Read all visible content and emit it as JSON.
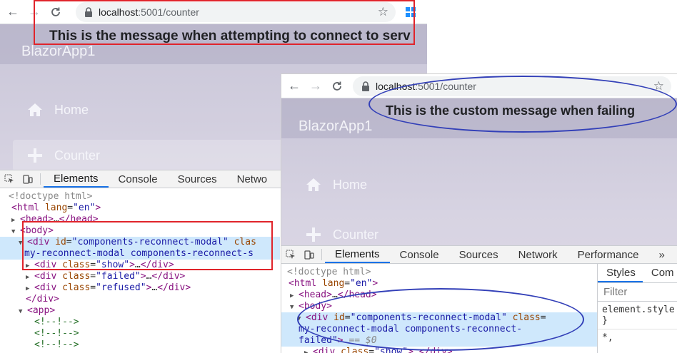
{
  "shot1": {
    "url_host": "localhost",
    "url_path": ":5001/counter",
    "reconnect_message": "This is the message when attempting to connect to serv",
    "brand": "BlazorApp1",
    "nav": [
      {
        "label": "Home",
        "icon": "home-icon"
      },
      {
        "label": "Counter",
        "icon": "plus-icon"
      }
    ],
    "devtools_tabs": [
      "Elements",
      "Console",
      "Sources",
      "Netwo"
    ],
    "dom": {
      "doctype": "<!doctype html>",
      "html_tag": "html",
      "html_lang_attr": "lang",
      "html_lang_val": "\"en\"",
      "head": "head",
      "head_ellipsis": "…",
      "body": "body",
      "div_tag": "div",
      "id_attr": "id",
      "modal_id": "\"components-reconnect-modal\"",
      "class_attr_trunc": "clas",
      "modal_classes": "my-reconnect-modal components-reconnect-s",
      "class_attr": "class",
      "show_val": "\"show\"",
      "failed_val": "\"failed\"",
      "refused_val": "\"refused\"",
      "ellipsis": "…",
      "div_close": "</div>",
      "app_tag": "app",
      "comment": "<!--!-->"
    }
  },
  "shot2": {
    "url_host": "localhost",
    "url_path": ":5001/counter",
    "failed_message": "This is the custom message when failing",
    "brand": "BlazorApp1",
    "nav": [
      {
        "label": "Home",
        "icon": "home-icon"
      },
      {
        "label": "Counter",
        "icon": "plus-icon"
      }
    ],
    "devtools_tabs": [
      "Elements",
      "Console",
      "Sources",
      "Network",
      "Performance"
    ],
    "more_tabs": "»",
    "styles_tabs": [
      "Styles",
      "Com"
    ],
    "filter_placeholder": "Filter",
    "style_rule_1": "element.style",
    "style_rule_1_close": "}",
    "style_rule_2": "*,",
    "dom": {
      "doctype": "<!doctype html>",
      "html_tag": "html",
      "html_lang_attr": "lang",
      "html_lang_val": "\"en\"",
      "head": "head",
      "body": "body",
      "div_tag": "div",
      "id_attr": "id",
      "modal_id": "\"components-reconnect-modal\"",
      "class_attr": "class",
      "modal_classes_1": "my-reconnect-modal components-reconnect-",
      "modal_classes_2": "failed",
      "dollar_zero": "== $0",
      "show_val": "\"show\"",
      "ellipsis": "…",
      "div_close": "</div>"
    }
  }
}
